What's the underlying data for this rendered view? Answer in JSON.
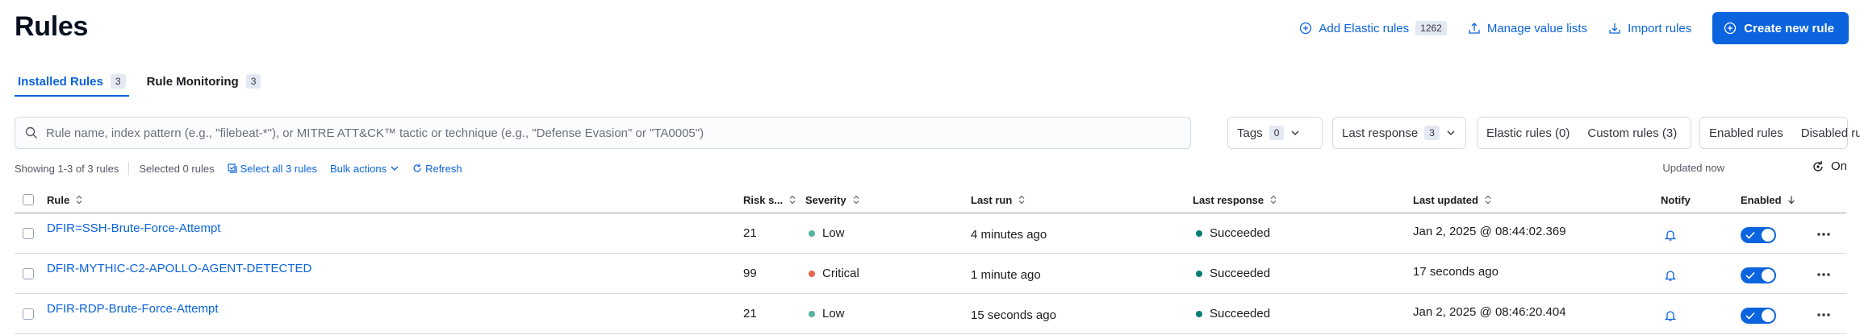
{
  "page": {
    "title": "Rules"
  },
  "header_actions": {
    "add_elastic_rules": "Add Elastic rules",
    "add_elastic_rules_count": "1262",
    "manage_value_lists": "Manage value lists",
    "import_rules": "Import rules",
    "create_new_rule": "Create new rule"
  },
  "tabs": [
    {
      "label": "Installed Rules",
      "count": "3",
      "active": true
    },
    {
      "label": "Rule Monitoring",
      "count": "3",
      "active": false
    }
  ],
  "search": {
    "placeholder": "Rule name, index pattern (e.g., \"filebeat-*\"), or MITRE ATT&CK™ tactic or technique (e.g., \"Defense Evasion\" or \"TA0005\")",
    "value": ""
  },
  "filters": {
    "tags": {
      "label": "Tags",
      "count": "0"
    },
    "last_response": {
      "label": "Last response",
      "count": "3"
    },
    "elastic_rules": "Elastic rules (0)",
    "custom_rules": "Custom rules (3)",
    "enabled_rules": "Enabled rules",
    "disabled_rules": "Disabled rules"
  },
  "utility_bar": {
    "showing": "Showing 1-3 of 3 rules",
    "selected": "Selected 0 rules",
    "select_all": "Select all 3 rules",
    "bulk_actions": "Bulk actions",
    "refresh": "Refresh",
    "updated": "Updated now",
    "auto_refresh": "On"
  },
  "table": {
    "columns": {
      "rule": "Rule",
      "risk_score": "Risk s...",
      "severity": "Severity",
      "last_run": "Last run",
      "last_response": "Last response",
      "last_updated": "Last updated",
      "notify": "Notify",
      "enabled": "Enabled"
    },
    "rows": [
      {
        "rule": "DFIR=SSH-Brute-Force-Attempt",
        "risk_score": "21",
        "severity": "Low",
        "last_run": "4 minutes ago",
        "last_response": "Succeeded",
        "last_updated": "Jan 2, 2025 @ 08:44:02.369",
        "enabled": true
      },
      {
        "rule": "DFIR-MYTHIC-C2-APOLLO-AGENT-DETECTED",
        "risk_score": "99",
        "severity": "Critical",
        "last_run": "1 minute ago",
        "last_response": "Succeeded",
        "last_updated": "17 seconds ago",
        "enabled": true
      },
      {
        "rule": "DFIR-RDP-Brute-Force-Attempt",
        "risk_score": "21",
        "severity": "Low",
        "last_run": "15 seconds ago",
        "last_response": "Succeeded",
        "last_updated": "Jan 2, 2025 @ 08:46:20.404",
        "enabled": true
      }
    ]
  },
  "colors": {
    "accent": "#0b64dd",
    "severity_low": "#54b399",
    "severity_critical": "#e7664c",
    "response_succeeded": "#017d73"
  }
}
